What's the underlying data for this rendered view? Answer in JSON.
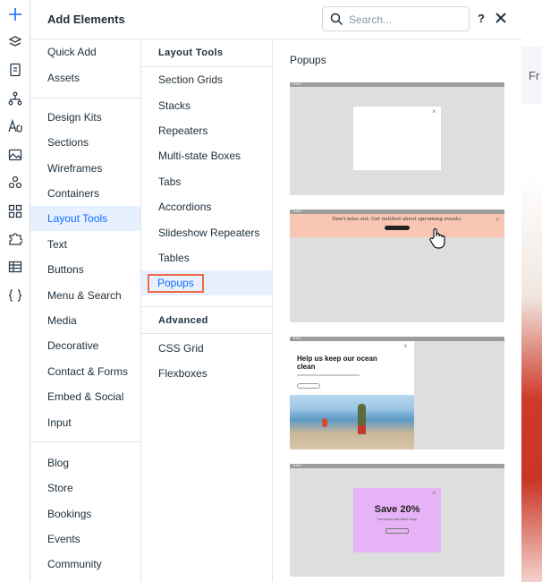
{
  "header": {
    "title": "Add Elements",
    "search_placeholder": "Search...",
    "help_label": "?"
  },
  "rail_icons": [
    "plus-icon",
    "layers-icon",
    "page-icon",
    "sitemap-icon",
    "text-theme-icon",
    "image-icon",
    "apps-icon",
    "grid-icon",
    "puzzle-icon",
    "table-icon",
    "code-icon"
  ],
  "categories": {
    "group1": [
      "Quick Add",
      "Assets"
    ],
    "group2": [
      "Design Kits",
      "Sections",
      "Wireframes",
      "Containers",
      "Layout Tools",
      "Text",
      "Buttons",
      "Menu & Search",
      "Media",
      "Decorative",
      "Contact & Forms",
      "Embed & Social",
      "Input"
    ],
    "group3": [
      "Blog",
      "Store",
      "Bookings",
      "Events",
      "Community"
    ],
    "active": "Layout Tools"
  },
  "layout_tools": {
    "heading": "Layout Tools",
    "items": [
      "Section Grids",
      "Stacks",
      "Repeaters",
      "Multi-state Boxes",
      "Tabs",
      "Accordions",
      "Slideshow Repeaters",
      "Tables",
      "Popups"
    ],
    "active": "Popups"
  },
  "advanced": {
    "heading": "Advanced",
    "items": [
      "CSS Grid",
      "Flexboxes"
    ]
  },
  "popups": {
    "title": "Popups",
    "card2_text": "Don't miss out. Get notified about upcoming events.",
    "card3_heading": "Help us keep our ocean clean",
    "card4_heading": "Save 20%",
    "card4_sub": "Your spring sale starts today."
  },
  "site_preview": {
    "text": "Fr"
  },
  "colors": {
    "accent": "#116dff",
    "highlight_bg": "#e7f0ff",
    "callout_border": "#ef6a4a"
  }
}
